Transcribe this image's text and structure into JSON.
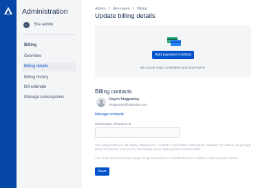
{
  "sidebar": {
    "title": "Administration",
    "back_label": "Site admin",
    "back_icon": "arrow-left-icon",
    "section_heading": "Billing",
    "items": [
      {
        "label": "Overview"
      },
      {
        "label": "Billing details",
        "active": true
      },
      {
        "label": "Billing history"
      },
      {
        "label": "Bill estimate"
      },
      {
        "label": "Manage subscriptions"
      }
    ]
  },
  "breadcrumbs": [
    "Admin",
    "dev-rayen",
    "Billing"
  ],
  "breadcrumb_separator": "/",
  "page_title": "Update billing details",
  "payment": {
    "button_label": "Add payment method",
    "accept_text": "We accept major credit/debit cards and PayPal."
  },
  "contacts": {
    "heading": "Billing contacts",
    "name": "Rayen Magpantay",
    "email": "rmagpantay@atlassian.com",
    "manage_label": "Manage contacts",
    "copies_label": "Send copies of invoices to",
    "copies_value": ""
  },
  "notes": {
    "statement": "Your billing statement will display Atlassian B.V., located in Amsterdam, Netherlands. Atlassian Pty Limited, our principal place of business, is at Level 6, 341 George Street, Sydney NSW Australia 2000.",
    "fees": "Your credit card issuer may charge foreign transaction or cross-border fees in addition to the total price above."
  },
  "save_label": "Save",
  "colors": {
    "brand": "#0052cc",
    "rail": "#0747a6",
    "sidebar": "#f4f5f7"
  }
}
